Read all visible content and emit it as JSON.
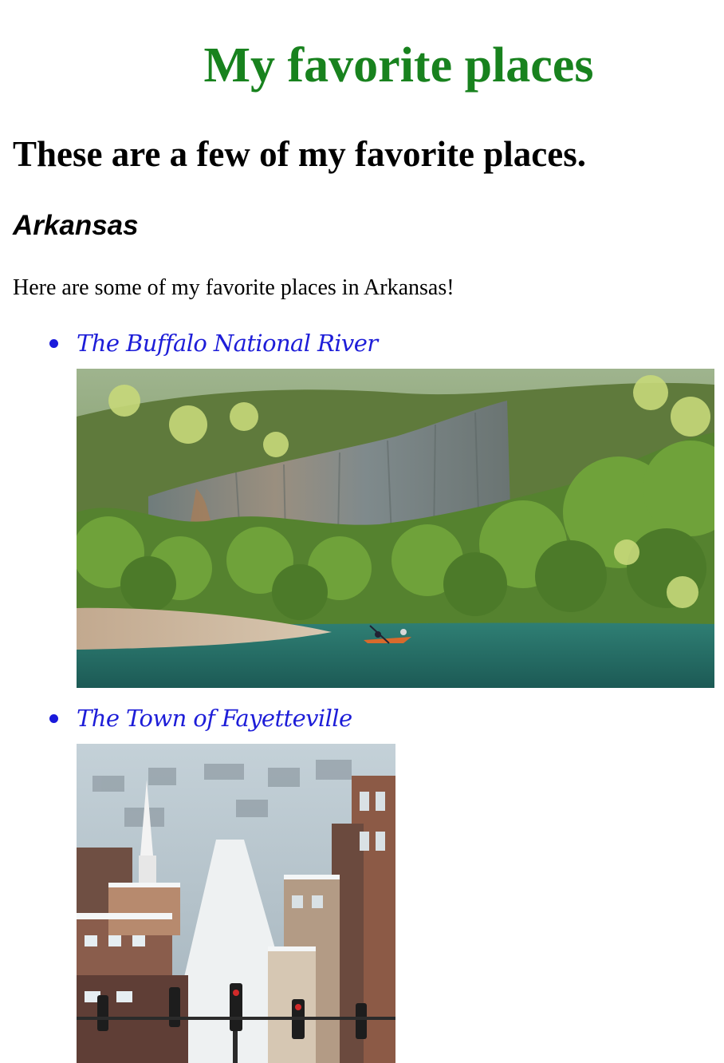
{
  "header": {
    "title": "My favorite places",
    "title_color": "#18821e"
  },
  "main": {
    "subtitle": "These are a few of my favorite places.",
    "section_heading": "Arkansas",
    "intro": "Here are some of my favorite places in Arkansas!",
    "link_color": "#1d1dd8",
    "places": [
      {
        "label": "The Buffalo National River",
        "image": "river-bluff-kayak-photo"
      },
      {
        "label": "The Town of Fayetteville",
        "image": "snowy-town-street-photo"
      }
    ]
  }
}
